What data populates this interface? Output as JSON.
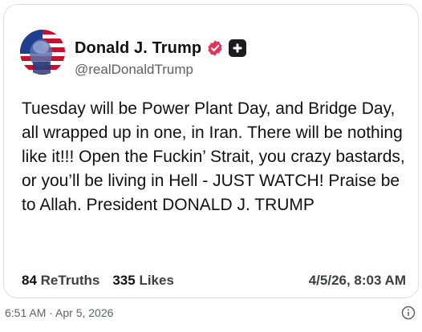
{
  "post": {
    "display_name": "Donald J. Trump",
    "handle": "@realDonaldTrump",
    "verified_icon": "verified-badge-icon",
    "verified_color": "#e5335c",
    "plus_icon": "plus-square-icon",
    "body": "Tuesday will be Power Plant Day, and Bridge Day, all wrapped up in one, in Iran. There will be nothing like it!!! Open the Fuckin’ Strait, you crazy bastards, or you’ll be living in Hell - JUST WATCH! Praise be to Allah. President DONALD J. TRUMP",
    "retruths_count": "84",
    "retruths_label": "ReTruths",
    "likes_count": "335",
    "likes_label": "Likes",
    "timestamp": "4/5/26, 8:03 AM"
  },
  "footer": {
    "time": "6:51 AM · Apr 5, 2026",
    "info_icon": "info-icon"
  }
}
